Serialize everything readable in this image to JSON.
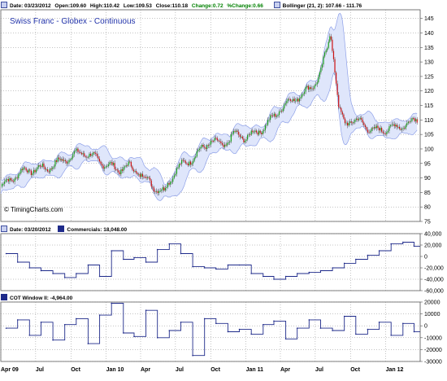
{
  "header": {
    "date": "Date: 03/23/2012",
    "open": "Open:109.60",
    "high": "High:110.42",
    "low": "Low:109.53",
    "close": "Close:110.18",
    "change": "Change:0.72",
    "pct_change": "%Change:0.66",
    "bollinger": "Bollinger (21, 2): 107.66 - 111.76"
  },
  "title": "Swiss Franc - Globex - Continuous",
  "watermark": "© TimingCharts.com",
  "panel2_header": {
    "date": "Date: 03/20/2012",
    "label": "Commercials: 18,048.00"
  },
  "panel3_header": {
    "label": "COT Window II: -4,964.00"
  },
  "x_axis_labels": [
    "Apr 09",
    "Jul",
    "Oct",
    "Jan 10",
    "Apr",
    "Jul",
    "Oct",
    "Jan 11",
    "Apr",
    "Jul",
    "Oct",
    "Jan 12"
  ],
  "colors": {
    "up": "#1aa01a",
    "down": "#cc1111",
    "line": "#1e2a8a",
    "band": "#dfe6fb",
    "band_edge": "#8ea0e8",
    "title": "#2233aa",
    "grid": "#888888"
  },
  "chart_data": [
    {
      "type": "candlestick",
      "title": "Swiss Franc - Globex - Continuous",
      "ylim": [
        75,
        148
      ],
      "yticks": [
        75,
        80,
        85,
        90,
        95,
        100,
        105,
        110,
        115,
        120,
        125,
        130,
        135,
        140,
        145
      ],
      "overlay": "Bollinger (21, 2)",
      "x": [
        "2009-04-01",
        "2009-05-01",
        "2009-06-01",
        "2009-07-01",
        "2009-08-01",
        "2009-09-01",
        "2009-10-01",
        "2009-11-01",
        "2009-12-01",
        "2010-01-01",
        "2010-02-01",
        "2010-03-01",
        "2010-04-01",
        "2010-05-01",
        "2010-06-01",
        "2010-07-01",
        "2010-08-01",
        "2010-09-01",
        "2010-10-01",
        "2010-11-01",
        "2010-12-01",
        "2011-01-01",
        "2011-02-01",
        "2011-03-01",
        "2011-04-01",
        "2011-05-01",
        "2011-06-01",
        "2011-07-01",
        "2011-07-15",
        "2011-08-01",
        "2011-08-09",
        "2011-08-20",
        "2011-09-01",
        "2011-09-15",
        "2011-10-01",
        "2011-11-01",
        "2011-12-01",
        "2012-01-01",
        "2012-02-01",
        "2012-03-01",
        "2012-03-23"
      ],
      "close": [
        87,
        90,
        92.5,
        93,
        93.5,
        95.5,
        97.5,
        99,
        97,
        94.5,
        93,
        94,
        91.5,
        87.5,
        85,
        93,
        95.5,
        99,
        103,
        101,
        105,
        104,
        106,
        109,
        114,
        117,
        119,
        123,
        126,
        135,
        141,
        129,
        113,
        109,
        110,
        109,
        106,
        107,
        107.5,
        109,
        110.18
      ],
      "grid": true
    },
    {
      "type": "line",
      "title": "Commercials",
      "ylim": [
        -60000,
        40000
      ],
      "yticks": [
        -60000,
        -40000,
        -20000,
        0,
        20000,
        40000
      ],
      "x": [
        "2009-04",
        "2009-05",
        "2009-06",
        "2009-07",
        "2009-08",
        "2009-09",
        "2009-10",
        "2009-11",
        "2009-12",
        "2010-01",
        "2010-02",
        "2010-03",
        "2010-04",
        "2010-05",
        "2010-06",
        "2010-07",
        "2010-08",
        "2010-09",
        "2010-10",
        "2010-11",
        "2010-12",
        "2011-01",
        "2011-02",
        "2011-03",
        "2011-04",
        "2011-05",
        "2011-06",
        "2011-07",
        "2011-08",
        "2011-09",
        "2011-10",
        "2011-11",
        "2011-12",
        "2012-01",
        "2012-02",
        "2012-03"
      ],
      "values": [
        5000,
        -10000,
        -20000,
        -25000,
        -30000,
        -37000,
        -30000,
        -15000,
        -35000,
        10000,
        -5000,
        -2000,
        -10000,
        12000,
        22000,
        5000,
        -18000,
        -20000,
        -22000,
        -15000,
        -15000,
        -30000,
        -35000,
        -40000,
        -35000,
        -30000,
        -28000,
        -25000,
        -20000,
        -12000,
        -5000,
        2000,
        10000,
        22000,
        25000,
        18048
      ],
      "grid": true
    },
    {
      "type": "line",
      "title": "COT Window II",
      "ylim": [
        -30000,
        20000
      ],
      "yticks": [
        -30000,
        -20000,
        -10000,
        0,
        10000,
        20000
      ],
      "x": [
        "2009-04",
        "2009-05",
        "2009-06",
        "2009-07",
        "2009-08",
        "2009-09",
        "2009-10",
        "2009-11",
        "2009-12",
        "2010-01",
        "2010-02",
        "2010-03",
        "2010-04",
        "2010-05",
        "2010-06",
        "2010-07",
        "2010-08",
        "2010-09",
        "2010-10",
        "2010-11",
        "2010-12",
        "2011-01",
        "2011-02",
        "2011-03",
        "2011-04",
        "2011-05",
        "2011-06",
        "2011-07",
        "2011-08",
        "2011-09",
        "2011-10",
        "2011-11",
        "2011-12",
        "2012-01",
        "2012-02",
        "2012-03"
      ],
      "values": [
        -2000,
        5000,
        -8000,
        3000,
        -12000,
        1000,
        6000,
        -15000,
        9000,
        19000,
        -6000,
        -9000,
        13000,
        -10000,
        -4000,
        3000,
        -25000,
        6000,
        2000,
        -5000,
        -3000,
        -7000,
        1000,
        4000,
        -11000,
        -2000,
        5000,
        -2000,
        -4000,
        8000,
        -7000,
        -3000,
        3000,
        -8000,
        2000,
        -4964
      ],
      "grid": true
    }
  ]
}
